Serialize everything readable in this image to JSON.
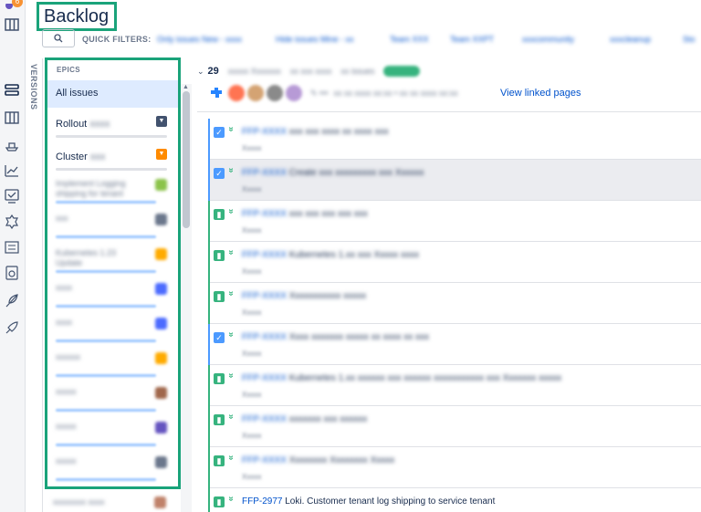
{
  "header": {
    "title": "Backlog"
  },
  "quick_filters": {
    "label": "QUICK FILTERS:",
    "items": [
      "Only issues New - xxxx",
      "Hide issues Mine - xx",
      "Team XXX",
      "Team XXPT",
      "xxxcommunity",
      "xxxcleanup",
      "Sto"
    ]
  },
  "sidebar": {
    "versions_label": "VERSIONS"
  },
  "epics": {
    "header": "EPICS",
    "all_issues": "All issues",
    "named": [
      {
        "label": "Rollout",
        "suffix": "xxxx",
        "color": "#42526e"
      },
      {
        "label": "Cluster",
        "suffix": "xxx",
        "color": "#ff8b00"
      }
    ],
    "blurred": [
      {
        "line1": "Implement Logging",
        "line2": "shipping for tenant",
        "color": "#8bc34a"
      },
      {
        "line1": "xxx",
        "line2": "",
        "color": "#6b778c"
      },
      {
        "line1": "Kubernetes 1.23",
        "line2": "Update",
        "color": "#ffab00"
      },
      {
        "line1": "xxxx",
        "line2": "",
        "color": "#4c6bff"
      },
      {
        "line1": "xxxx",
        "line2": "",
        "color": "#4c6bff"
      },
      {
        "line1": "xxxxxx",
        "line2": "",
        "color": "#ffab00"
      },
      {
        "line1": "xxxxx",
        "line2": "",
        "color": "#a0674b"
      },
      {
        "line1": "xxxxx",
        "line2": "",
        "color": "#6554c0"
      },
      {
        "line1": "xxxxx",
        "line2": "",
        "color": "#6b778c"
      }
    ],
    "below": {
      "line1": "xxxxxxxx xxxx",
      "color": "#c0826a"
    }
  },
  "sprint": {
    "number": "29",
    "name": "xxxxx Xxxxxxx",
    "dates": "xx xxx xxxx",
    "issue_count": "xx issues",
    "meta": "xx xx xxxx xx:xx • xx xx xxxx xx:xx",
    "view_linked": "View linked pages",
    "avatars": [
      "#ff7452",
      "#d4a373",
      "#8a8a8a",
      "#b79ad6"
    ]
  },
  "issues": [
    {
      "type": "task",
      "key": "FFP-XXXX",
      "summary": "xxx xxx xxxx xx xxxx xxx",
      "sub": "Xxxxx",
      "bar": "#4c9aff",
      "selected": false
    },
    {
      "type": "task",
      "key": "FFP-XXXX",
      "summary": "Create xxx xxxxxxxxx xxx Xxxxxx",
      "sub": "Xxxxx",
      "bar": "#4c9aff",
      "selected": true
    },
    {
      "type": "story",
      "key": "FFP-XXXX",
      "summary": "xxx xxx xxx xxx xxx",
      "sub": "Xxxxx",
      "bar": "#36b37e",
      "selected": false
    },
    {
      "type": "story",
      "key": "FFP-XXXX",
      "summary": "Kubernetes 1.xx xxx Xxxxx xxxx",
      "sub": "Xxxxx",
      "bar": "#36b37e",
      "selected": false
    },
    {
      "type": "story",
      "key": "FFP-XXXX",
      "summary": "Xxxxxxxxxxx xxxxx",
      "sub": "Xxxxx",
      "bar": "#36b37e",
      "selected": false
    },
    {
      "type": "task",
      "key": "FFP-XXXX",
      "summary": "Xxxx xxxxxxx xxxxx xx xxxx xx xxx",
      "sub": "Xxxxx",
      "bar": "#4c9aff",
      "selected": false
    },
    {
      "type": "story",
      "key": "FFP-XXXX",
      "summary": "Kubernetes 1.xx xxxxxx xxx xxxxxx xxxxxxxxxxx xxx Xxxxxxx xxxxx",
      "sub": "Xxxxx",
      "bar": "#36b37e",
      "selected": false
    },
    {
      "type": "story",
      "key": "FFP-XXXX",
      "summary": "xxxxxxx xxx xxxxxx",
      "sub": "Xxxxx",
      "bar": "#36b37e",
      "selected": false
    },
    {
      "type": "story",
      "key": "FFP-XXXX",
      "summary": "Xxxxxxxx Xxxxxxxx Xxxxx",
      "sub": "Xxxxx",
      "bar": "#36b37e",
      "selected": false
    },
    {
      "type": "story",
      "key": "FFP-2977",
      "summary": "Loki. Customer tenant log shipping to service tenant",
      "sub": "",
      "bar": "#36b37e",
      "selected": false,
      "clear": true
    }
  ]
}
